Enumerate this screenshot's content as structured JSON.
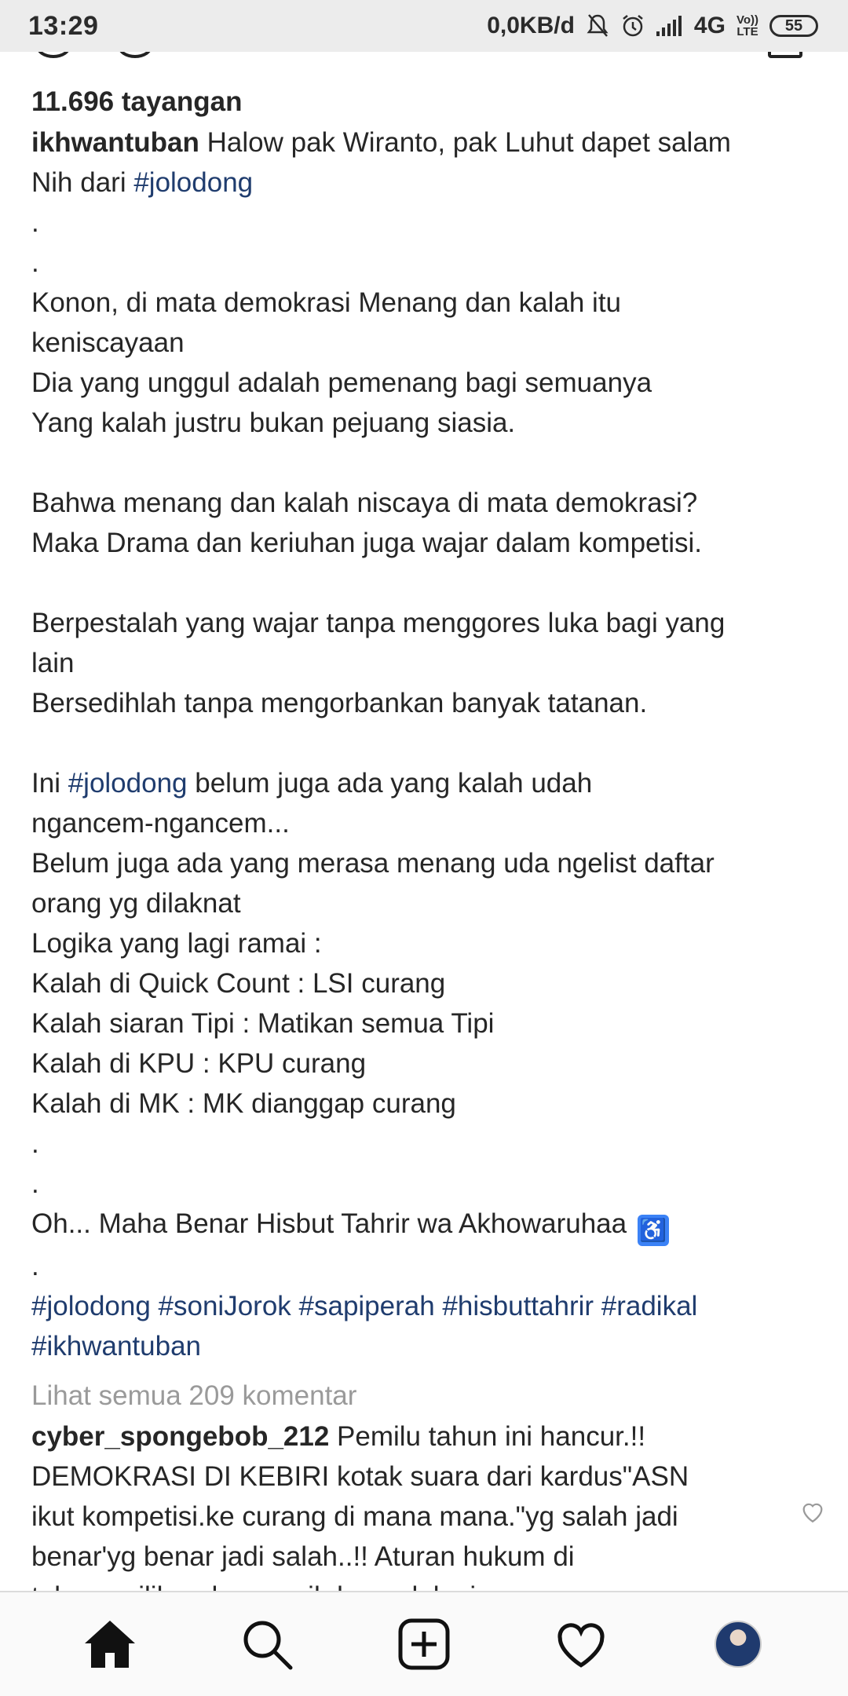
{
  "status_bar": {
    "time": "13:29",
    "network_speed": "0,0KB/d",
    "network_type": "4G",
    "volte_line1": "Vo))",
    "volte_line2": "LTE",
    "battery": "55"
  },
  "post": {
    "views": "11.696 tayangan",
    "username": "ikhwantuban",
    "caption_lines": [
      " Halow pak Wiranto, pak Luhut dapet salam\nNih dari ",
      "#jolodong",
      "\n.\n.\nKonon, di mata demokrasi Menang dan kalah itu\nkeniscayaan\nDia yang unggul adalah pemenang bagi semuanya\nYang kalah justru bukan pejuang siasia.\n\nBahwa menang dan kalah niscaya di mata demokrasi?\nMaka Drama dan keriuhan juga wajar dalam kompetisi.\n\nBerpestalah yang wajar tanpa menggores luka bagi yang\nlain\nBersedihlah tanpa mengorbankan banyak tatanan.\n\nIni ",
      "#jolodong",
      " belum juga ada yang kalah udah\nngancem-ngancem...\nBelum juga ada yang merasa menang uda ngelist daftar\norang yg dilaknat\nLogika yang lagi ramai :\nKalah di Quick Count : LSI curang\nKalah siaran Tipi : Matikan semua Tipi\nKalah di KPU : KPU curang\nKalah di MK : MK dianggap curang\n.\n.\nOh... Maha Benar Hisbut Tahrir wa Akhowaruhaa ",
      "\n.\n",
      "#jolodong #soniJorok #sapiperah #hisbuttahrir #radikal\n#ikhwantuban"
    ],
    "accessibility_emoji": "♿",
    "view_all_comments": "Lihat semua 209 komentar"
  },
  "comment": {
    "username": "cyber_spongebob_212",
    "text": " Pemilu tahun ini hancur.!!\nDEMOKRASI DI KEBIRI kotak suara dari kardus\"ASN\nikut kompetisi.ke curang di mana mana.\"yg salah jadi\nbenar'yg benar jadi salah..!! Aturan hukum di\ntebang pilih... dan masih banyak lagi..."
  },
  "colors": {
    "hashtag": "#1f3c6e",
    "muted": "#9a9a9a",
    "text": "#262626"
  },
  "nav": [
    "home-icon",
    "search-icon",
    "new-post-icon",
    "activity-heart-icon",
    "profile-avatar"
  ]
}
